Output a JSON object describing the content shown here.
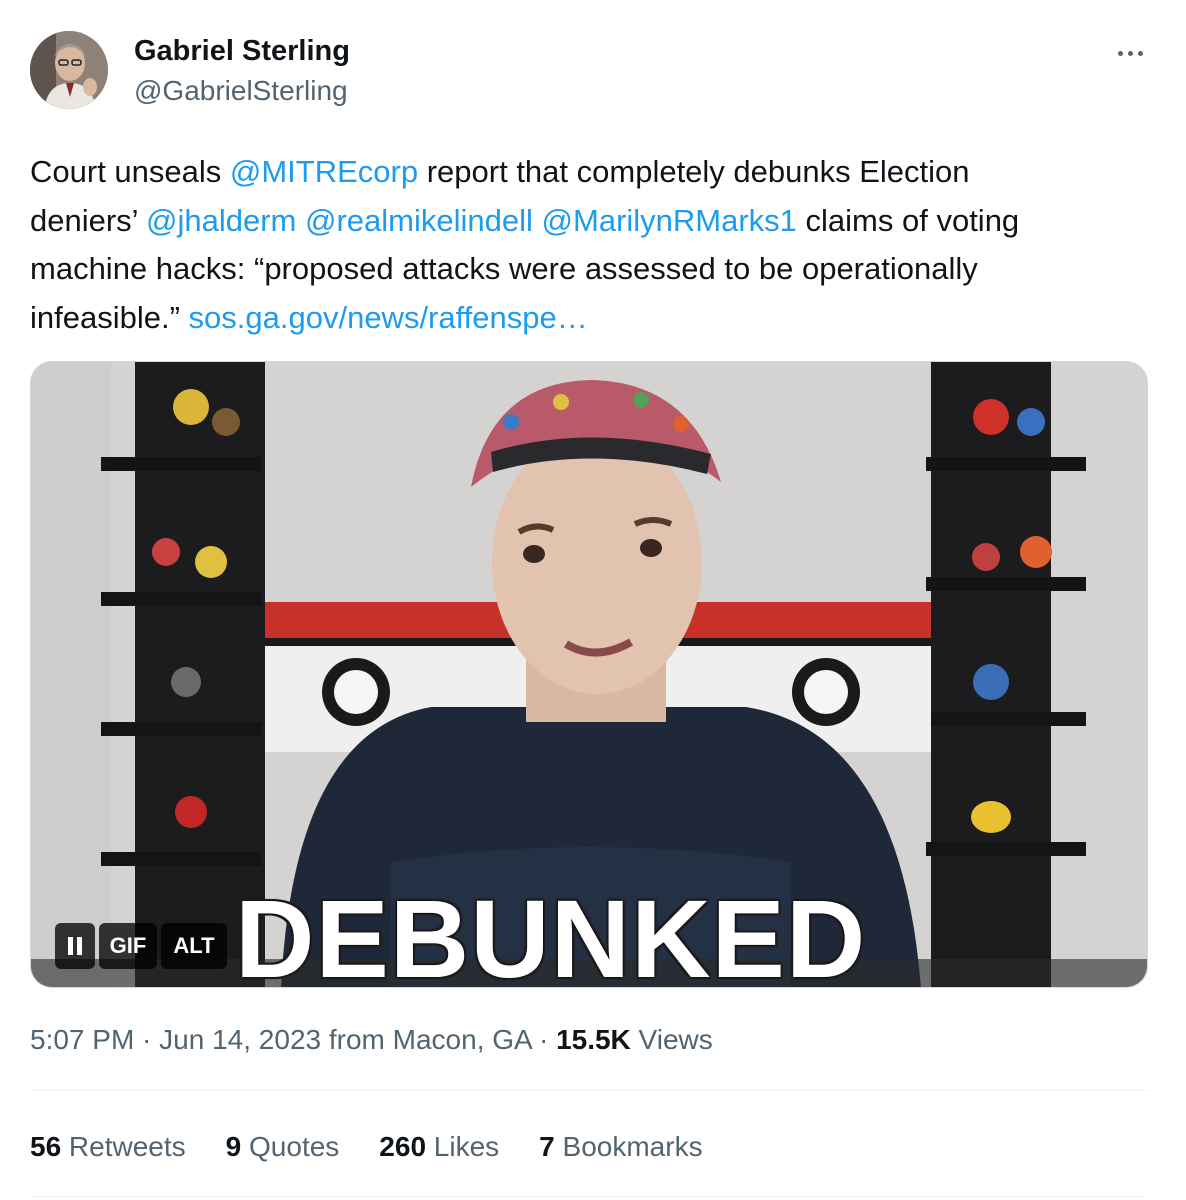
{
  "author": {
    "name": "Gabriel Sterling",
    "handle": "@GabrielSterling"
  },
  "more_icon": "more-horizontal-icon",
  "text": {
    "l1a": "Court unseals ",
    "m1": "@MITREcorp",
    "l1b": " report that completely debunks Election",
    "l2a": "deniers’ ",
    "m2": "@jhalderm",
    "m3": "@realmikelindell",
    "m4": "@MarilynRMarks1",
    "l2b": " claims of voting",
    "l3": "machine hacks: “proposed attacks were assessed to be operationally",
    "l4a": "infeasible.” ",
    "url": "sos.ga.gov/news/raffenspe…"
  },
  "media": {
    "gif_label": "GIF",
    "alt_label": "ALT",
    "pause_icon": "pause-icon",
    "overlay_text": "DEBUNKED"
  },
  "meta": {
    "time": "5:07 PM",
    "sep": " · ",
    "date": "Jun 14, 2023",
    "from": " from Macon, GA",
    "views_count": "15.5K",
    "views_label": " Views"
  },
  "stats": [
    {
      "count": "56",
      "label": " Retweets"
    },
    {
      "count": "9",
      "label": " Quotes"
    },
    {
      "count": "260",
      "label": " Likes"
    },
    {
      "count": "7",
      "label": " Bookmarks"
    }
  ],
  "colors": {
    "accent": "#1d9bf0",
    "text": "#0f1419",
    "secondary": "#536471"
  }
}
